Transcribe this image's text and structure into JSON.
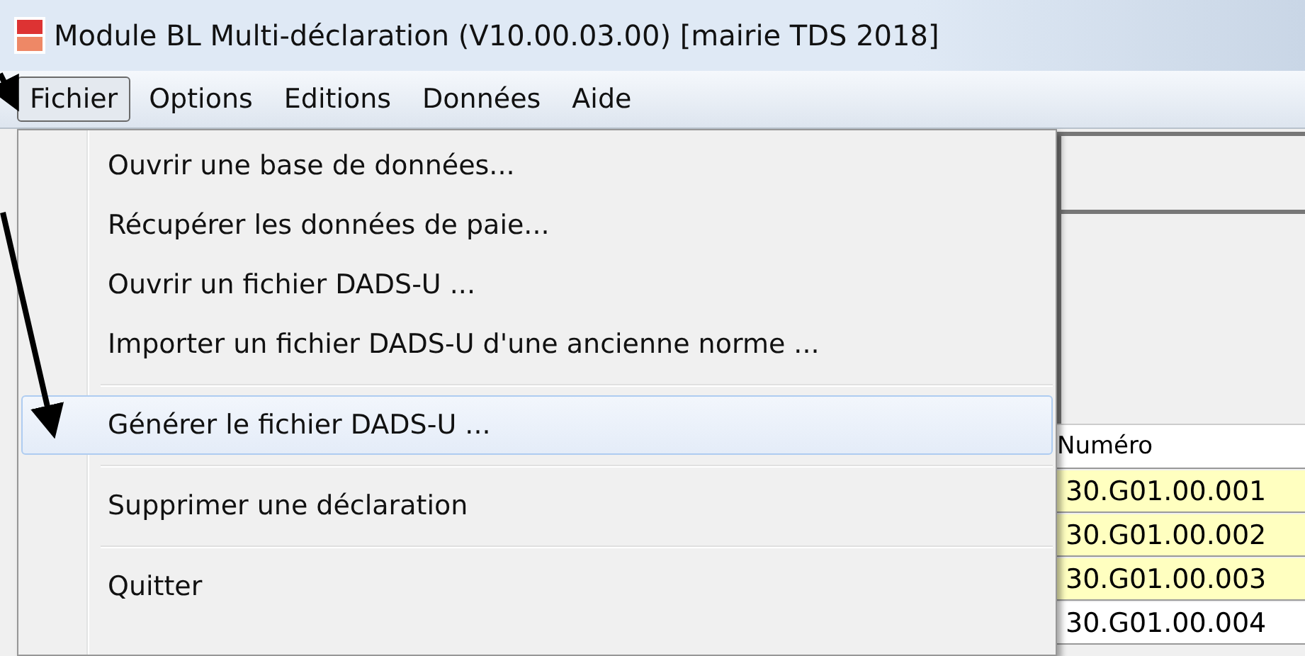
{
  "window": {
    "title": "Module BL Multi-déclaration (V10.00.03.00) [mairie TDS 2018]"
  },
  "menubar": [
    {
      "label": "Fichier",
      "selected": true
    },
    {
      "label": "Options",
      "selected": false
    },
    {
      "label": "Editions",
      "selected": false
    },
    {
      "label": "Données",
      "selected": false
    },
    {
      "label": "Aide",
      "selected": false
    }
  ],
  "menu": [
    {
      "kind": "item",
      "label": "Ouvrir une base de données...",
      "selected": false
    },
    {
      "kind": "item",
      "label": "Récupérer les données de paie...",
      "selected": false
    },
    {
      "kind": "item",
      "label": "Ouvrir un fichier DADS-U ...",
      "selected": false
    },
    {
      "kind": "item",
      "label": "Importer un fichier DADS-U d'une ancienne norme ...",
      "selected": false
    },
    {
      "kind": "separator"
    },
    {
      "kind": "item",
      "label": "Générer le fichier DADS-U ...",
      "selected": true
    },
    {
      "kind": "separator"
    },
    {
      "kind": "item",
      "label": "Supprimer une déclaration",
      "selected": false
    },
    {
      "kind": "separator"
    },
    {
      "kind": "item",
      "label": "Quitter",
      "selected": false
    }
  ],
  "table": {
    "columns": [
      "Numéro"
    ],
    "rows": [
      {
        "cell": "30.G01.00.001",
        "selected": true
      },
      {
        "cell": "30.G01.00.002",
        "selected": true
      },
      {
        "cell": "30.G01.00.003",
        "selected": true
      },
      {
        "cell": "30.G01.00.004",
        "selected": false
      }
    ]
  }
}
